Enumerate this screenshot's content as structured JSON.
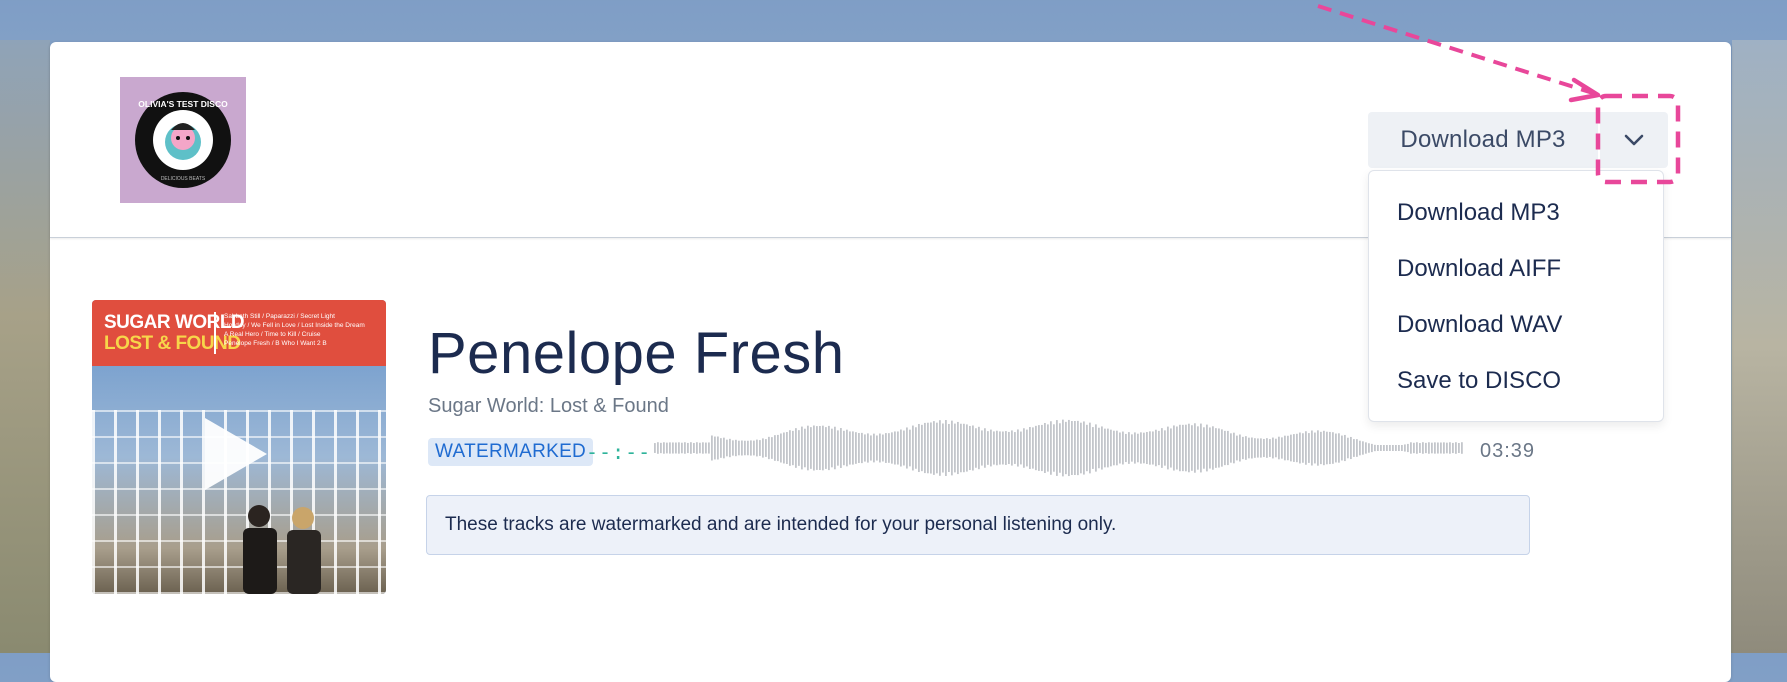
{
  "header": {
    "logo_text": "OLIVIA'S TEST DISCO",
    "logo_subtext": "DELICIOUS BEATS"
  },
  "download": {
    "main_label": "Download MP3",
    "menu": [
      {
        "label": "Download MP3"
      },
      {
        "label": "Download AIFF"
      },
      {
        "label": "Download WAV"
      },
      {
        "label": "Save to DISCO"
      }
    ]
  },
  "artwork": {
    "title_line1": "SUGAR WORLD",
    "title_line2": "LOST & FOUND",
    "tracklist": "Sabbath Still / Paparazzi / Secret Light\nHoliday / We Fell in Love / Lost Inside the Dream\nA Real Hero / Time to Kill / Cruise\nPenelope Fresh / B Who I Want 2 B"
  },
  "track": {
    "title": "Penelope Fresh",
    "album": "Sugar World: Lost & Found",
    "badge": "WATERMARKED",
    "elapsed": "--:--",
    "duration": "03:39"
  },
  "notice": "These tracks are watermarked and are intended for your personal listening only.",
  "colors": {
    "accent_pink": "#e8479a",
    "badge_blue": "#1f6bd1",
    "elapsed_green": "#2eb39a",
    "title_navy": "#1c2b4f"
  }
}
